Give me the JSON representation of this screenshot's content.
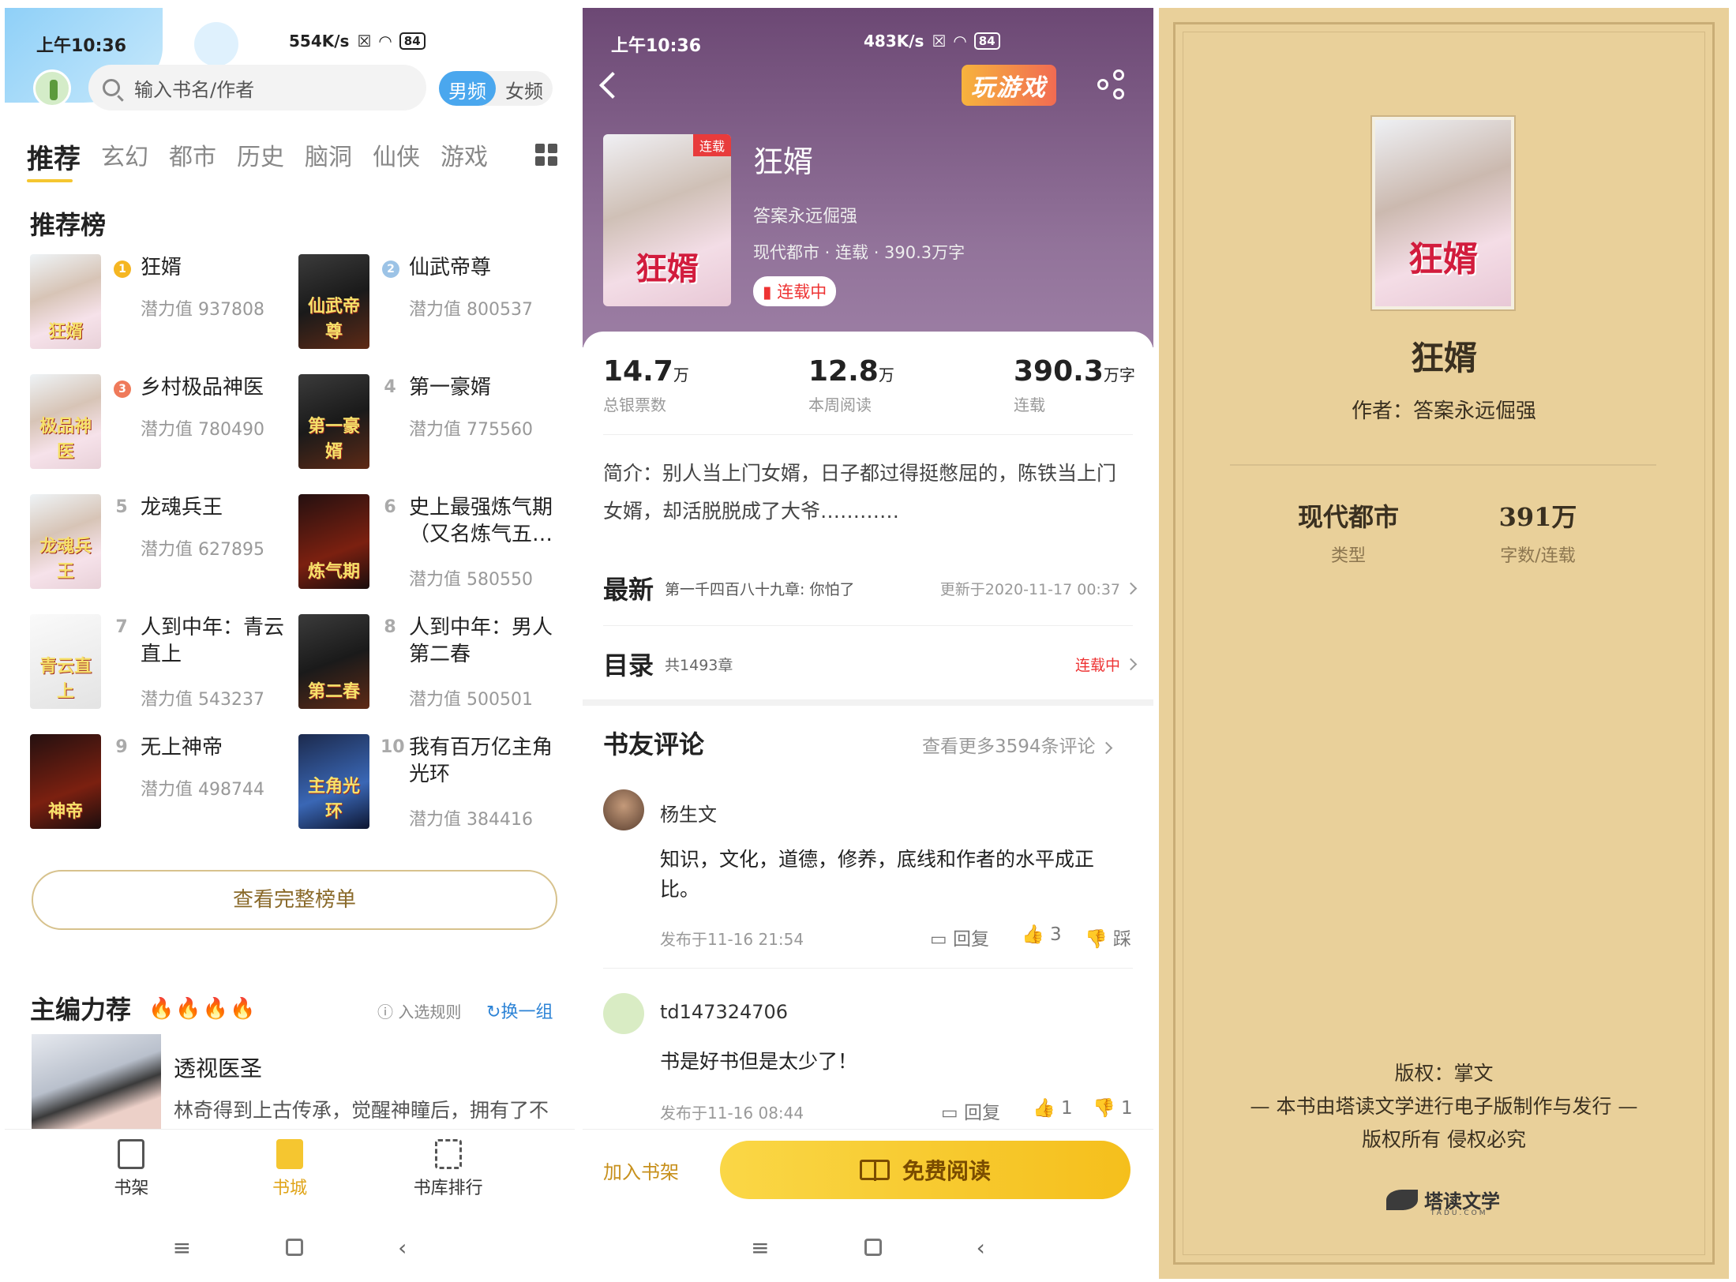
{
  "shelf": {
    "status_bar": {
      "time": "上午10:36",
      "speed": "554K/s",
      "battery": "84"
    },
    "search": {
      "placeholder": "输入书名/作者"
    },
    "gender": {
      "male": "男频",
      "female": "女频"
    },
    "tabs": [
      "推荐",
      "玄幻",
      "都市",
      "历史",
      "脑洞",
      "仙侠",
      "游戏"
    ],
    "ranking_title": "推荐榜",
    "ranking": [
      {
        "rank": "1",
        "title": "狂婿",
        "score": "潜力值 937808",
        "cover_text": "狂婿"
      },
      {
        "rank": "2",
        "title": "仙武帝尊",
        "score": "潜力值 800537",
        "cover_text": "仙武帝尊"
      },
      {
        "rank": "3",
        "title": "乡村极品神医",
        "score": "潜力值 780490",
        "cover_text": "极品神医"
      },
      {
        "rank": "4",
        "title": "第一豪婿",
        "score": "潜力值 775560",
        "cover_text": "第一豪婿"
      },
      {
        "rank": "5",
        "title": "龙魂兵王",
        "score": "潜力值 627895",
        "cover_text": "龙魂兵王"
      },
      {
        "rank": "6",
        "title": "史上最强炼气期（又名炼气五…",
        "score": "潜力值 580550",
        "cover_text": "炼气期"
      },
      {
        "rank": "7",
        "title": "人到中年：青云直上",
        "score": "潜力值 543237",
        "cover_text": "青云直上"
      },
      {
        "rank": "8",
        "title": "人到中年：男人第二春",
        "score": "潜力值 500501",
        "cover_text": "第二春"
      },
      {
        "rank": "9",
        "title": "无上神帝",
        "score": "潜力值 498744",
        "cover_text": "神帝"
      },
      {
        "rank": "10",
        "title": "我有百万亿主角光环",
        "score": "潜力值 384416",
        "cover_text": "主角光环"
      }
    ],
    "full_list_button": "查看完整榜单",
    "editor_title": "主编力荐",
    "editor_rules": "入选规则",
    "editor_refresh": "换一组",
    "editor_book": {
      "title": "透视医圣",
      "desc": "林奇得到上古传承，觉醒神瞳后，拥有了不可思议的能力，他不甘于一个平凡人医生"
    },
    "nav": [
      "书架",
      "书城",
      "书库排行"
    ]
  },
  "detail": {
    "status_bar": {
      "time": "上午10:36",
      "speed": "483K/s",
      "battery": "84"
    },
    "game_badge": "玩游戏",
    "cover_tag": "连载",
    "cover_text": "狂婿",
    "title": "狂婿",
    "author": "答案永远倔强",
    "meta": "现代都市 · 连载 · 390.3万字",
    "status": "连载中",
    "stats": [
      {
        "value": "14.7",
        "unit": "万",
        "label": "总银票数"
      },
      {
        "value": "12.8",
        "unit": "万",
        "label": "本周阅读"
      },
      {
        "value": "390.3",
        "unit": "万字",
        "label": "连载"
      }
    ],
    "intro": "简介：别人当上门女婿，日子都过得挺憋屈的，陈铁当上门女婿，却活脱脱成了大爷…………",
    "latest": {
      "head": "最新",
      "chapter": "第一千四百八十九章:  你怕了",
      "updated": "更新于2020-11-17 00:37"
    },
    "toc": {
      "head": "目录",
      "count": "共1493章",
      "status": "连载中"
    },
    "comments_title": "书友评论",
    "comments_more": "查看更多3594条评论",
    "comments": [
      {
        "name": "杨生文",
        "text": "知识，文化，道德，修养，底线和作者的水平成正比。",
        "time": "发布于11-16 21:54",
        "reply": "回复",
        "likes": "3",
        "dislike": "踩"
      },
      {
        "name": "td147324706",
        "text": "书是好书但是太少了！",
        "time": "发布于11-16 08:44",
        "reply": "回复",
        "likes": "1",
        "dislike": "1"
      }
    ],
    "add_shelf": "加入书架",
    "read_button": "免费阅读"
  },
  "reader": {
    "cover_text": "狂婿",
    "title": "狂婿",
    "author": "作者：答案永远倔强",
    "genre": {
      "value": "现代都市",
      "label": "类型"
    },
    "words": {
      "value": "391万",
      "label": "字数/连载"
    },
    "copyright": "版权：掌文",
    "publisher": "— 本书由塔读文学进行电子版制作与发行 —",
    "rights": "版权所有 侵权必究",
    "logo": "塔读文学",
    "logo_sub": "TADU.COM"
  },
  "colors": {
    "accent_yellow": "#f5c630",
    "male_blue": "#4aa7ee",
    "hero_purple": "#6c4874",
    "parchment": "#e9d09a"
  }
}
